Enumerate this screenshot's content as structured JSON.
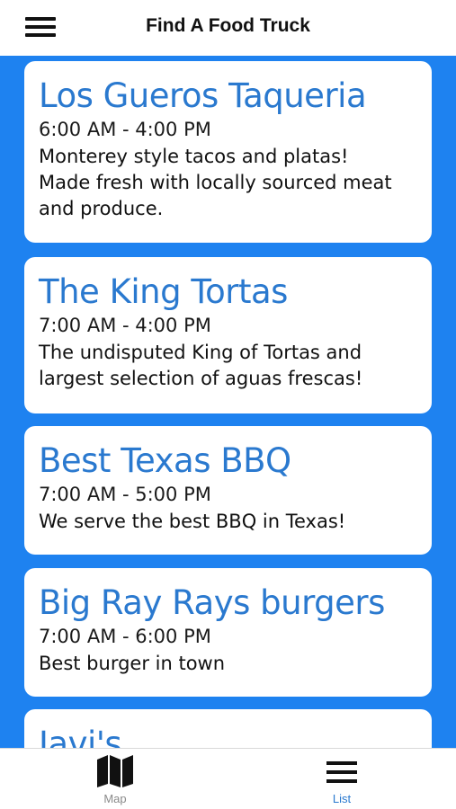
{
  "header": {
    "title": "Find A Food Truck",
    "menu_icon": "hamburger-menu-icon"
  },
  "trucks": [
    {
      "name": "Los Gueros Taqueria",
      "hours": "6:00 AM - 4:00 PM",
      "description_lines": [
        "Monterey style tacos and platas!",
        "Made fresh with locally sourced meat",
        "and produce."
      ]
    },
    {
      "name": "The King Tortas",
      "hours": "7:00 AM - 4:00 PM",
      "description_lines": [
        "The undisputed King of Tortas and",
        "largest selection of aguas frescas!"
      ]
    },
    {
      "name": "Best Texas BBQ",
      "hours": "7:00 AM - 5:00 PM",
      "description_lines": [
        "We serve the best BBQ in Texas!"
      ]
    },
    {
      "name": "Big Ray Rays burgers",
      "hours": "7:00 AM - 6:00 PM",
      "description_lines": [
        "Best burger in town"
      ]
    },
    {
      "name": "Javi's"
    }
  ],
  "tabbar": {
    "tabs": [
      {
        "label": "Map",
        "icon": "map-icon",
        "active": false
      },
      {
        "label": "List",
        "icon": "list-icon",
        "active": true
      }
    ]
  },
  "colors": {
    "list_background": "#1E82F0",
    "truck_name": "#2A79CF",
    "active_tab": "#2A79CF",
    "inactive_tab": "#8a8a8a"
  }
}
